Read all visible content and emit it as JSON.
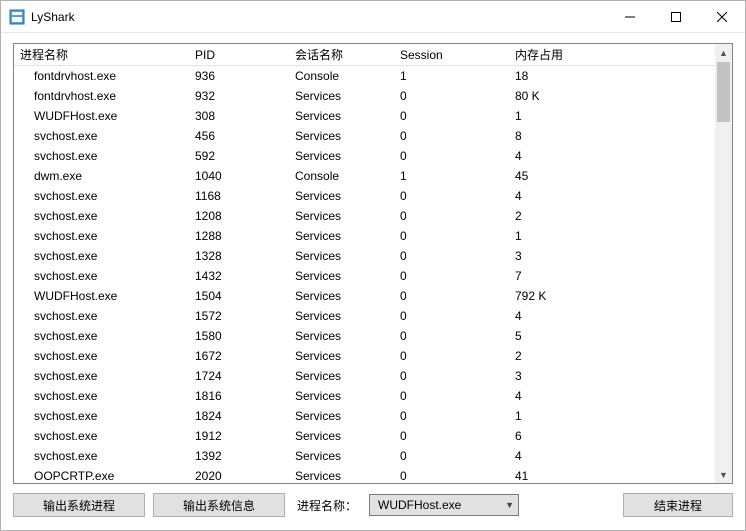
{
  "window": {
    "title": "LyShark"
  },
  "columns": {
    "c0": "进程名称",
    "c1": "PID",
    "c2": "会话名称",
    "c3": "Session",
    "c4": "内存占用"
  },
  "rows": [
    {
      "name": "fontdrvhost.exe",
      "pid": "936",
      "sess": "Console",
      "s": "1",
      "mem": "18"
    },
    {
      "name": "fontdrvhost.exe",
      "pid": "932",
      "sess": "Services",
      "s": "0",
      "mem": "80 K"
    },
    {
      "name": "WUDFHost.exe",
      "pid": "308",
      "sess": "Services",
      "s": "0",
      "mem": "1"
    },
    {
      "name": "svchost.exe",
      "pid": "456",
      "sess": "Services",
      "s": "0",
      "mem": "8"
    },
    {
      "name": "svchost.exe",
      "pid": "592",
      "sess": "Services",
      "s": "0",
      "mem": "4"
    },
    {
      "name": "dwm.exe",
      "pid": "1040",
      "sess": "Console",
      "s": "1",
      "mem": "45"
    },
    {
      "name": "svchost.exe",
      "pid": "1168",
      "sess": "Services",
      "s": "0",
      "mem": "4"
    },
    {
      "name": "svchost.exe",
      "pid": "1208",
      "sess": "Services",
      "s": "0",
      "mem": "2"
    },
    {
      "name": "svchost.exe",
      "pid": "1288",
      "sess": "Services",
      "s": "0",
      "mem": "1"
    },
    {
      "name": "svchost.exe",
      "pid": "1328",
      "sess": "Services",
      "s": "0",
      "mem": "3"
    },
    {
      "name": "svchost.exe",
      "pid": "1432",
      "sess": "Services",
      "s": "0",
      "mem": "7"
    },
    {
      "name": "WUDFHost.exe",
      "pid": "1504",
      "sess": "Services",
      "s": "0",
      "mem": "792 K"
    },
    {
      "name": "svchost.exe",
      "pid": "1572",
      "sess": "Services",
      "s": "0",
      "mem": "4"
    },
    {
      "name": "svchost.exe",
      "pid": "1580",
      "sess": "Services",
      "s": "0",
      "mem": "5"
    },
    {
      "name": "svchost.exe",
      "pid": "1672",
      "sess": "Services",
      "s": "0",
      "mem": "2"
    },
    {
      "name": "svchost.exe",
      "pid": "1724",
      "sess": "Services",
      "s": "0",
      "mem": "3"
    },
    {
      "name": "svchost.exe",
      "pid": "1816",
      "sess": "Services",
      "s": "0",
      "mem": "4"
    },
    {
      "name": "svchost.exe",
      "pid": "1824",
      "sess": "Services",
      "s": "0",
      "mem": "1"
    },
    {
      "name": "svchost.exe",
      "pid": "1912",
      "sess": "Services",
      "s": "0",
      "mem": "6"
    },
    {
      "name": "svchost.exe",
      "pid": "1392",
      "sess": "Services",
      "s": "0",
      "mem": "4"
    },
    {
      "name": "OOPCRTP.exe",
      "pid": "2020",
      "sess": "Services",
      "s": "0",
      "mem": "41"
    }
  ],
  "bottom": {
    "btn_out_proc": "输出系统进程",
    "btn_out_info": "输出系统信息",
    "label_proc": "进程名称：",
    "combo_value": "WUDFHost.exe",
    "btn_end": "结束进程"
  }
}
